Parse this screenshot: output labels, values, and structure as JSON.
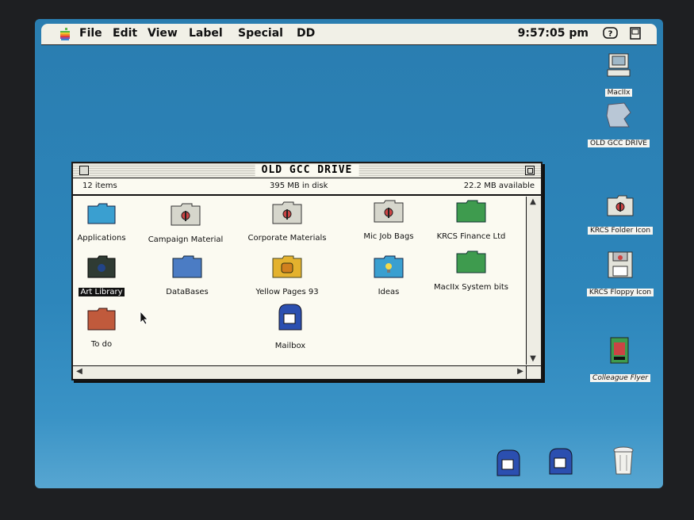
{
  "menubar": {
    "apple_icon": "apple-logo-icon",
    "items": [
      "File",
      "Edit",
      "View",
      "Label",
      "Special",
      "DD"
    ],
    "clock": "9:57:05 pm",
    "help_icon": "balloon-help-icon",
    "app_icon": "application-menu-icon"
  },
  "desktop": {
    "icons": [
      {
        "label": "MacIIx",
        "icon": "computer-icon"
      },
      {
        "label": "OLD GCC DRIVE",
        "icon": "hard-disk-icon"
      },
      {
        "label": "KRCS Folder Icon",
        "icon": "folder-icon"
      },
      {
        "label": "KRCS Floppy Icon",
        "icon": "floppy-icon"
      },
      {
        "label": "Colleague Flyer",
        "icon": "document-icon"
      },
      {
        "label": "",
        "icon": "mailbox-icon"
      },
      {
        "label": "",
        "icon": "mailbox-icon"
      },
      {
        "label": "",
        "icon": "trash-icon"
      }
    ]
  },
  "window": {
    "title": "OLD GCC DRIVE",
    "item_count": "12 items",
    "disk_usage": "395 MB in disk",
    "available": "22.2 MB available",
    "files": [
      {
        "label": "Applications",
        "icon": "folder-icon",
        "color": "#3a9fd0"
      },
      {
        "label": "Campaign Material",
        "icon": "folder-icon",
        "color": "#d6d6cc"
      },
      {
        "label": "Corporate Materials",
        "icon": "folder-icon",
        "color": "#d6d6cc"
      },
      {
        "label": "Mic Job Bags",
        "icon": "folder-icon",
        "color": "#d6d6cc"
      },
      {
        "label": "KRCS Finance Ltd",
        "icon": "folder-icon",
        "color": "#3e9b4e"
      },
      {
        "label": "Art Library",
        "icon": "folder-icon",
        "color": "#2f3b33"
      },
      {
        "label": "DataBases",
        "icon": "folder-icon",
        "color": "#4b7cc4"
      },
      {
        "label": "Yellow Pages 93",
        "icon": "folder-icon",
        "color": "#e4b22e"
      },
      {
        "label": "Ideas",
        "icon": "folder-icon",
        "color": "#3a9fd0"
      },
      {
        "label": "MacIIx System bits",
        "icon": "folder-icon",
        "color": "#3e9b4e"
      },
      {
        "label": "To do",
        "icon": "folder-icon",
        "color": "#c05a3c"
      },
      {
        "label": "Mailbox",
        "icon": "mailbox-icon",
        "color": "#2b4fb0"
      }
    ]
  }
}
